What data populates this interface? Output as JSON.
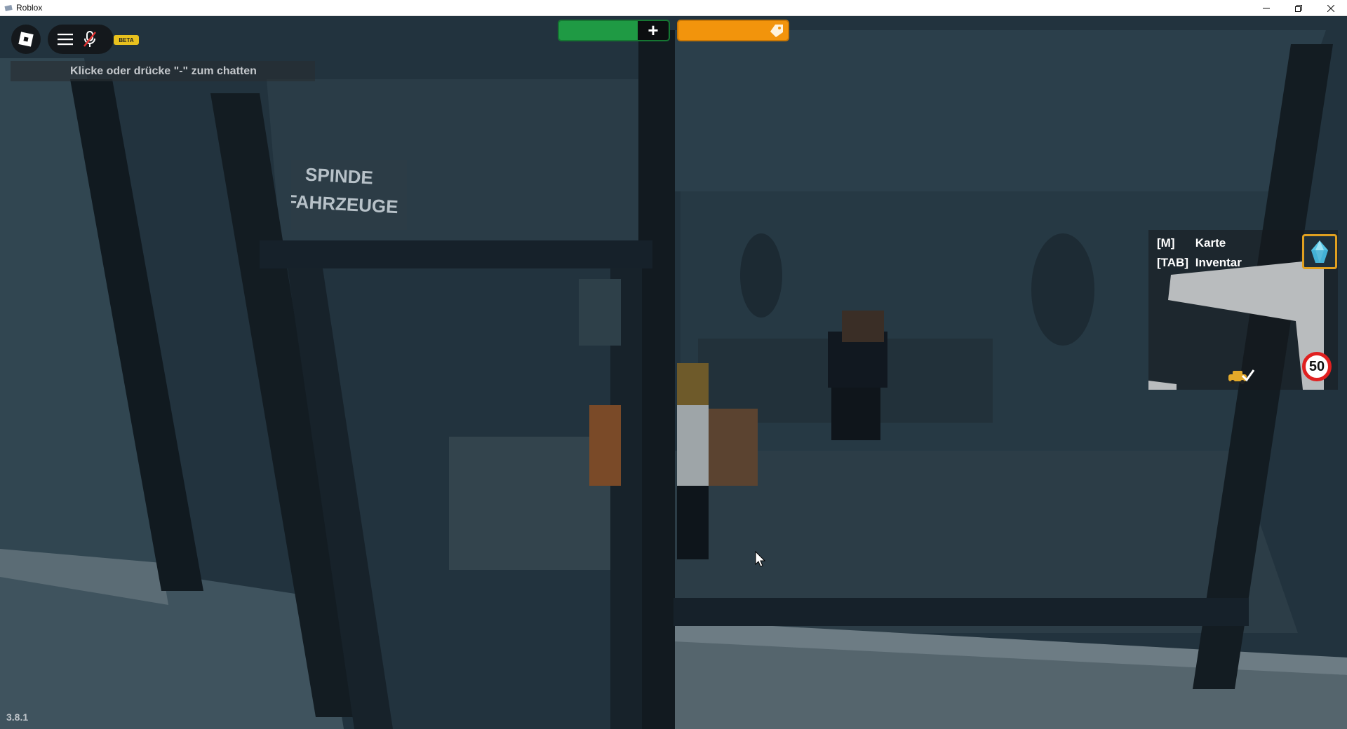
{
  "window": {
    "title": "Roblox"
  },
  "hud": {
    "chat_hint": "Klicke oder drücke \"-\" zum chatten",
    "beta_label": "BETA",
    "health_plus": "+",
    "keybinds": [
      {
        "key": "[M]",
        "label": "Karte"
      },
      {
        "key": "[TAB]",
        "label": "Inventar"
      }
    ],
    "speed_limit": "50",
    "version": "3.8.1"
  },
  "scene": {
    "sign_line1": "SPINDE",
    "sign_line2": "FAHRZEUGE"
  },
  "colors": {
    "health": "#1f9a44",
    "stamina": "#f2940c",
    "accent_gold": "#e0a020"
  },
  "icons": {
    "roblox_menu": "roblox-logo-icon",
    "menu": "hamburger-icon",
    "mic": "mic-muted-icon",
    "stamina": "tag-icon",
    "minimap_marker": "car-marker-icon",
    "crystal": "crystal-icon"
  }
}
